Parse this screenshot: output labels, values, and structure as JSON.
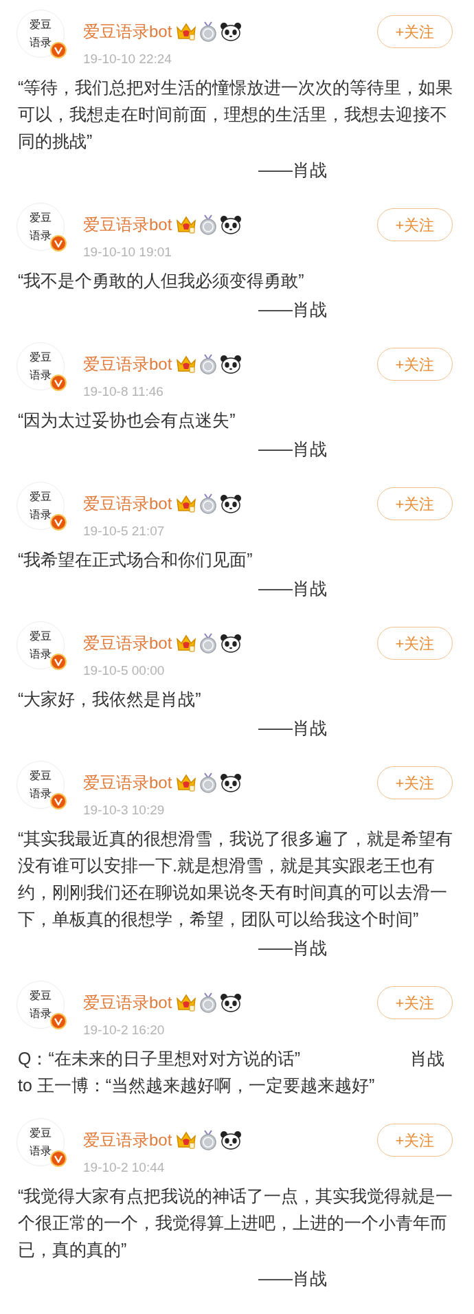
{
  "posts": [
    {
      "avatar_lines": [
        "爱豆",
        "语录"
      ],
      "verified": true,
      "name": "爱豆语录bot",
      "time": "19-10-10 22:24",
      "follow": "+关注",
      "text": "“等待，我们总把对生活的憧憬放进一次次的等待里，如果可以，我想走在时间前面，理想的生活里，我想去迎接不同的挑战”",
      "signature": "——肖战"
    },
    {
      "avatar_lines": [
        "爱豆",
        "语录"
      ],
      "verified": true,
      "name": "爱豆语录bot",
      "time": "19-10-10 19:01",
      "follow": "+关注",
      "text": "“我不是个勇敢的人但我必须变得勇敢”",
      "signature": "——肖战"
    },
    {
      "avatar_lines": [
        "爱豆",
        "语录"
      ],
      "verified": true,
      "name": "爱豆语录bot",
      "time": "19-10-8 11:46",
      "follow": "+关注",
      "text": "“因为太过妥协也会有点迷失”",
      "signature": "——肖战"
    },
    {
      "avatar_lines": [
        "爱豆",
        "语录"
      ],
      "verified": true,
      "name": "爱豆语录bot",
      "time": "19-10-5 21:07",
      "follow": "+关注",
      "text": "“我希望在正式场合和你们见面”",
      "signature": "——肖战"
    },
    {
      "avatar_lines": [
        "爱豆",
        "语录"
      ],
      "verified": true,
      "name": "爱豆语录bot",
      "time": "19-10-5 00:00",
      "follow": "+关注",
      "text": "“大家好，我依然是肖战”",
      "signature": "——肖战"
    },
    {
      "avatar_lines": [
        "爱豆",
        "语录"
      ],
      "verified": true,
      "name": "爱豆语录bot",
      "time": "19-10-3 10:29",
      "follow": "+关注",
      "text": "“其实我最近真的很想滑雪，我说了很多遍了，就是希望有没有谁可以安排一下.就是想滑雪，就是其实跟老王也有约，刚刚我们还在聊说如果说冬天有时间真的可以去滑一下，单板真的很想学，希望，团队可以给我这个时间”",
      "signature": "——肖战"
    },
    {
      "avatar_lines": [
        "爱豆",
        "语录"
      ],
      "verified": true,
      "name": "爱豆语录bot",
      "time": "19-10-2 16:20",
      "follow": "+关注",
      "text": "Q：“在未来的日子里想对对方说的话”                       肖战 to 王一博：“当然越来越好啊，一定要越来越好”"
    },
    {
      "avatar_lines": [
        "爱豆",
        "语录"
      ],
      "verified": true,
      "name": "爱豆语录bot",
      "time": "19-10-2 10:44",
      "follow": "+关注",
      "text": "“我觉得大家有点把我说的神话了一点，其实我觉得就是一个很正常的一个，我觉得算上进吧，上进的一个小青年而已，真的真的”",
      "signature": "——肖战"
    }
  ]
}
